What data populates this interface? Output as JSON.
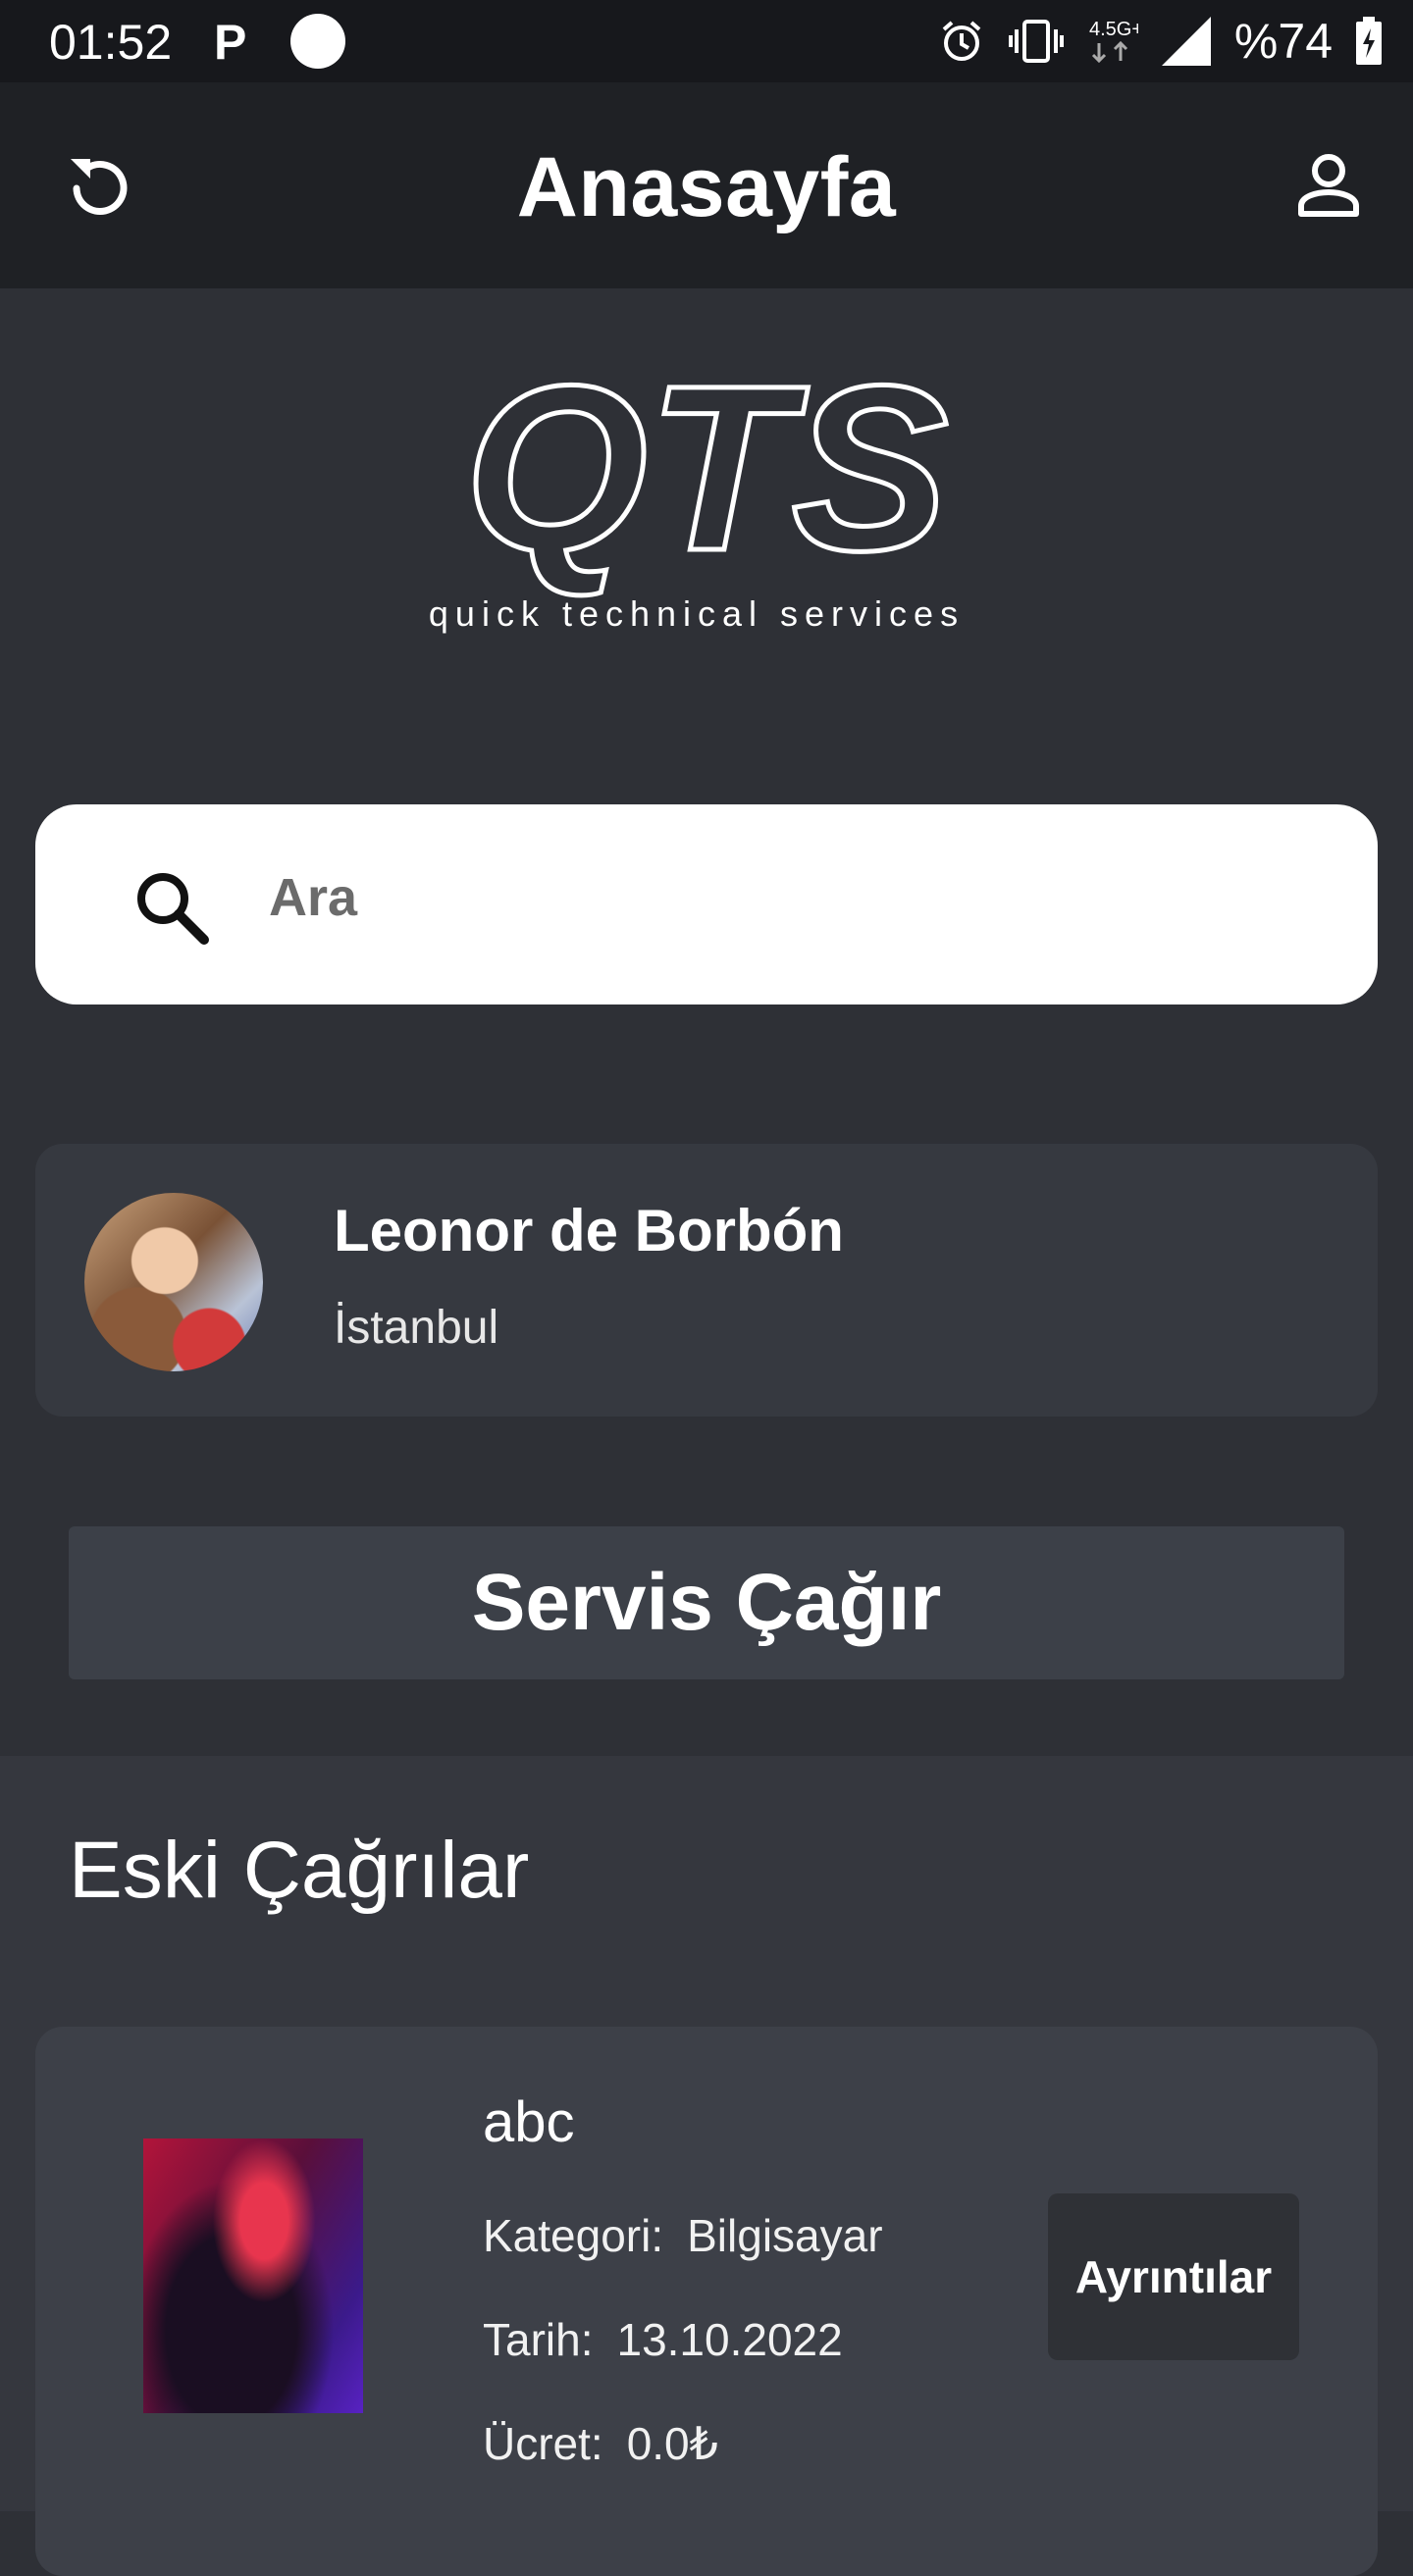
{
  "status_bar": {
    "time": "01:52",
    "p_icon_label": "P",
    "network": "4.5G+",
    "battery": "%74",
    "icons": [
      "alarm-icon",
      "vibrate-icon",
      "network-icon",
      "signal-icon",
      "battery-icon"
    ]
  },
  "header": {
    "title": "Anasayfa",
    "left_icon": "refresh-icon",
    "right_icon": "profile-icon"
  },
  "logo": {
    "mark": "QTS",
    "tagline": "quick technical services"
  },
  "search": {
    "placeholder": "Ara",
    "icon": "search-icon"
  },
  "profile": {
    "name": "Leonor de Borbón",
    "city": "İstanbul"
  },
  "actions": {
    "call_service": "Servis Çağır"
  },
  "history": {
    "title": "Eski Çağrılar",
    "items": [
      {
        "title": "abc",
        "category_label": "Kategori:",
        "category": "Bilgisayar",
        "date_label": "Tarih:",
        "date": "13.10.2022",
        "fee_label": "Ücret:",
        "fee": "0.0₺",
        "details_label": "Ayrıntılar"
      }
    ]
  },
  "colors": {
    "background": "#2e3036",
    "appbar": "#1f2125",
    "statusbar": "#17181c",
    "card": "#3d4048",
    "search_bg": "#ffffff"
  }
}
